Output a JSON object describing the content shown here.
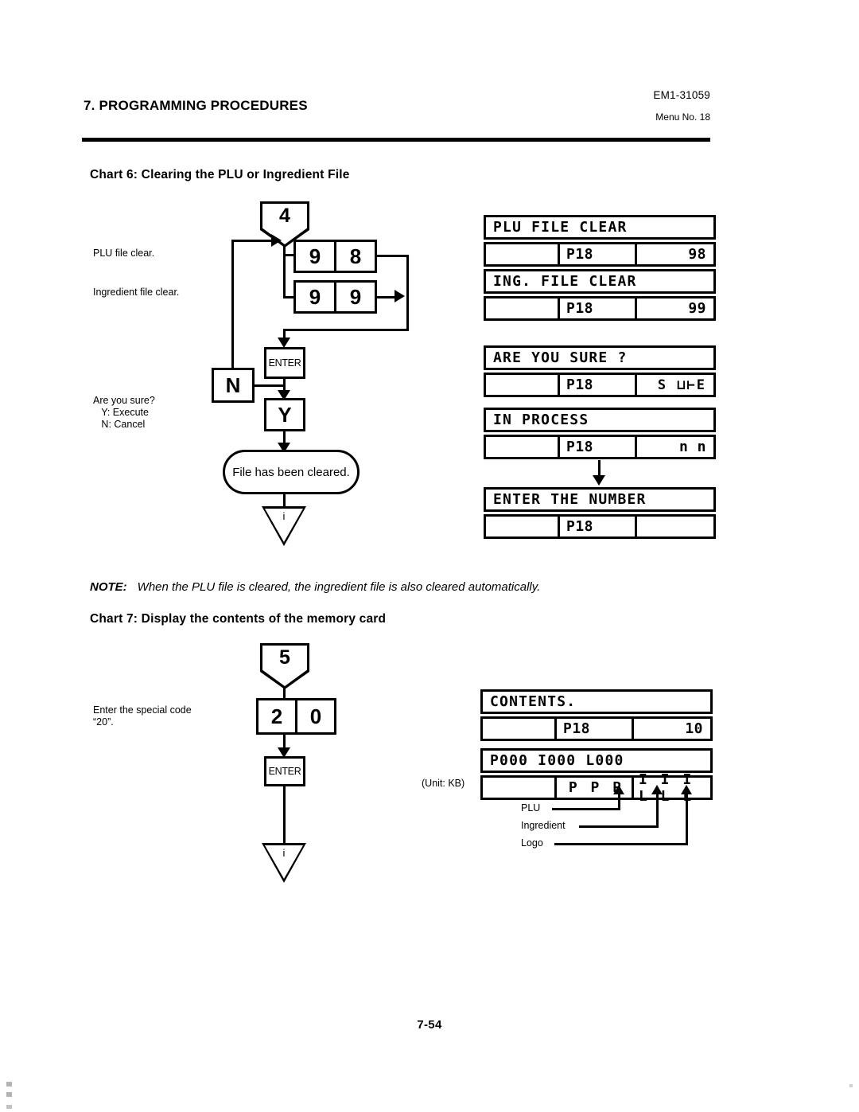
{
  "header": {
    "section_title": "7. PROGRAMMING PROCEDURES",
    "doc_number": "EM1-31059",
    "menu_number": "Menu No. 18"
  },
  "chart6": {
    "title": "Chart 6: Clearing the PLU or Ingredient File",
    "entry_connector": "4",
    "annotations": {
      "plu_file_clear": "PLU file clear.",
      "ingredient_file_clear": "Ingredient file clear.",
      "are_you_sure": "Are you sure?\n   Y: Execute\n   N: Cancel"
    },
    "keys": {
      "plu_row": [
        "9",
        "8"
      ],
      "ingredient_row": [
        "9",
        "9"
      ],
      "enter": "ENTER",
      "no": "N",
      "yes": "Y"
    },
    "terminator": "File has been cleared.",
    "exit_connector": "i",
    "displays": [
      {
        "message": "PLU FILE CLEAR",
        "field1": "",
        "field2": "P18",
        "field3": "98"
      },
      {
        "message": "ING. FILE CLEAR",
        "field1": "",
        "field2": "P18",
        "field3": "99"
      },
      {
        "message": "ARE YOU SURE ?",
        "field1": "",
        "field2": "P18",
        "field3": "S ⊔⊢E"
      },
      {
        "message": "IN PROCESS",
        "field1": "",
        "field2": "P18",
        "field3": "n n"
      },
      {
        "message": "ENTER THE NUMBER",
        "field1": "",
        "field2": "P18",
        "field3": ""
      }
    ]
  },
  "note": {
    "label": "NOTE:",
    "text": "When the PLU file is cleared, the ingredient file is also cleared automatically."
  },
  "chart7": {
    "title": "Chart 7: Display the contents of the memory card",
    "entry_connector": "5",
    "annotations": {
      "special_code": "Enter the special code\n“20”."
    },
    "keys": {
      "code_row": [
        "2",
        "0"
      ],
      "enter": "ENTER"
    },
    "exit_connector": "i",
    "unit_label": "(Unit: KB)",
    "displays": [
      {
        "message": "CONTENTS.",
        "field1": "",
        "field2": "P18",
        "field3": "10"
      },
      {
        "message": "P000 I000 L000",
        "field1": "",
        "field2": "P P P",
        "field3": "I I I L L L"
      }
    ],
    "callouts": [
      {
        "label": "PLU"
      },
      {
        "label": "Ingredient"
      },
      {
        "label": "Logo"
      }
    ]
  },
  "footer": {
    "page_number": "7-54"
  }
}
